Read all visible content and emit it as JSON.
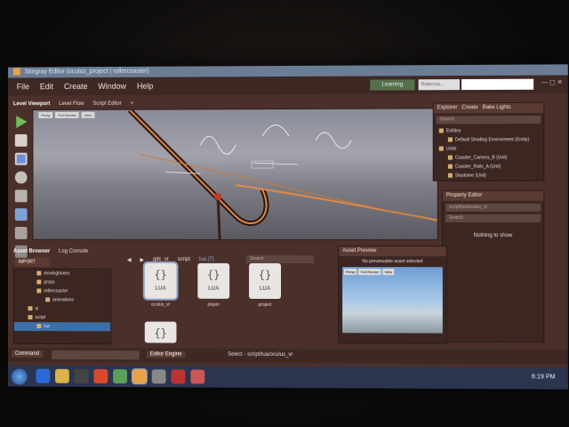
{
  "window": {
    "title": "Stingray Editor (oculus_project | rollercoaster)"
  },
  "menu": [
    "File",
    "Edit",
    "Create",
    "Window",
    "Help"
  ],
  "top_controls": {
    "learning": "Learning",
    "project": "Rollercoa...",
    "window_controls": "— ▢ ✕"
  },
  "viewport": {
    "tabs": [
      "Level Viewport",
      "Level Flow",
      "Script Editor"
    ],
    "toolbar": [
      "Persp",
      "Full Render",
      "View"
    ]
  },
  "explorer": {
    "tabs": [
      "Explorer",
      "Create",
      "Bake Lights"
    ],
    "search_placeholder": "Search",
    "items": [
      {
        "label": "Entities",
        "indent": 0
      },
      {
        "label": "Default Shading Environment (Entity)",
        "indent": 1
      },
      {
        "label": "Units",
        "indent": 0
      },
      {
        "label": "Coaster_Camera_B (Unit)",
        "indent": 1
      },
      {
        "label": "Coaster_Rails_A (Unit)",
        "indent": 1
      },
      {
        "label": "Skydome (Unit)",
        "indent": 1
      }
    ]
  },
  "property_editor": {
    "title": "Property Editor",
    "path": "script/lua/oculus_vr",
    "search_placeholder": "Search",
    "empty": "Nothing to show"
  },
  "asset_browser": {
    "tabs": [
      "Asset Browser",
      "Log Console"
    ],
    "import_label": "IMPORT",
    "breadcrumb": [
      "gdc_vr",
      "script",
      "lua (7)"
    ],
    "search_placeholder": "Search",
    "tree": [
      {
        "label": "movingboxes",
        "indent": 2
      },
      {
        "label": "props",
        "indent": 2
      },
      {
        "label": "rollercoaster",
        "indent": 2
      },
      {
        "label": "animations",
        "indent": 3
      },
      {
        "label": "ui",
        "indent": 1
      },
      {
        "label": "script",
        "indent": 1
      },
      {
        "label": "lua",
        "indent": 2
      }
    ],
    "tiles": [
      {
        "label": "oculus_vr",
        "ext": "LUA"
      },
      {
        "label": "player",
        "ext": "LUA"
      },
      {
        "label": "project",
        "ext": "LUA"
      },
      {
        "label": "",
        "ext": "LUA"
      }
    ]
  },
  "asset_preview": {
    "title": "Asset Preview",
    "message": "No previewable asset selected",
    "toolbar": [
      "Persp",
      "Full Render",
      "View"
    ]
  },
  "bottom": {
    "command_label": "Command",
    "engine": "Editor Engine",
    "status": "Select - script/lua/oculus_vr"
  },
  "taskbar": {
    "time": "6:19 PM"
  }
}
